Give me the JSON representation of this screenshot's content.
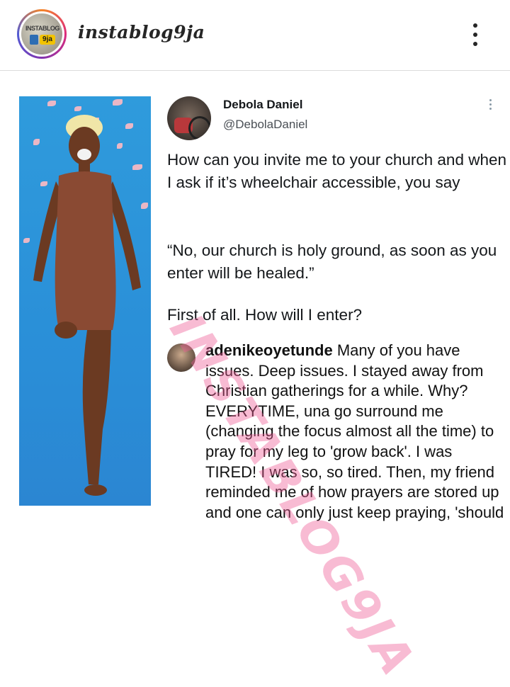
{
  "header": {
    "username": "instablog9ja",
    "avatar_logo_text": "INSTABLOG",
    "avatar_logo_badge": "9ja",
    "more_icon": "three-dots-vertical-icon"
  },
  "tweet": {
    "display_name": "Debola Daniel",
    "handle": "@DebolaDaniel",
    "more_icon": "three-dots-vertical-icon",
    "paragraphs": [
      "How can you invite me to your church and when I ask if it’s wheelchair accessible, you say",
      "“No, our church is holy ground, as soon as you enter will be healed.”",
      "First of all. How will I enter?"
    ]
  },
  "comment": {
    "username": "adenikeoyetunde",
    "text": "Many of you have issues. Deep issues. I stayed away from Christian gatherings for a while. Why? EVERYTIME, una go surround me (changing the focus almost all the time) to pray for my leg to 'grow back'. I was TIRED! I was so, so tired. Then, my friend reminded me of how prayers are stored up and one can only just keep praying, 'should"
  },
  "watermark": "INSTABLOG9JA",
  "colors": {
    "photo_background": "#2a8fd8",
    "watermark": "#ee5c96",
    "story_ring": [
      "#f58529",
      "#dd2a7b",
      "#8134af",
      "#515bd4"
    ]
  }
}
